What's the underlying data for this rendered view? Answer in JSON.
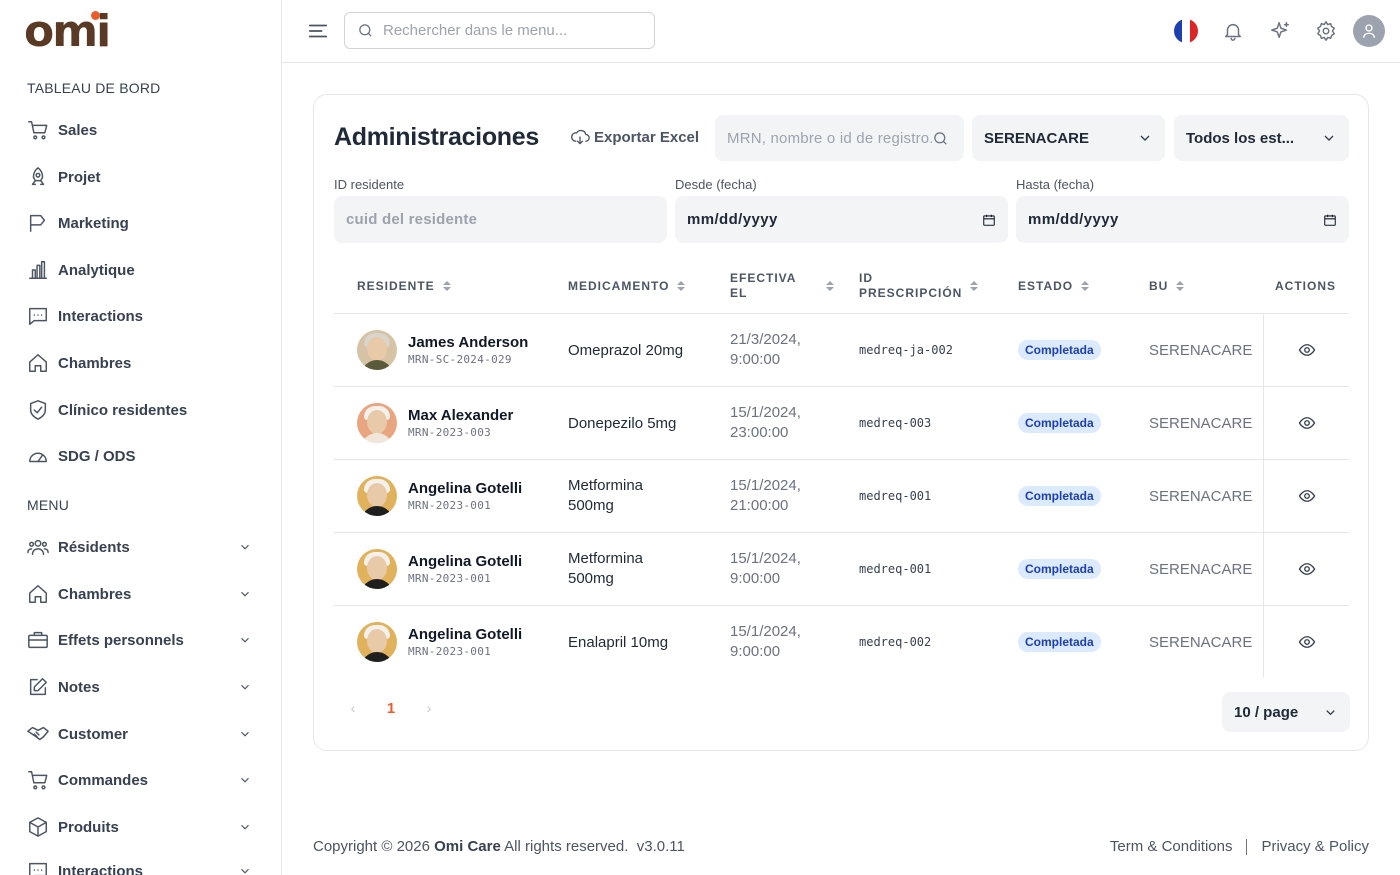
{
  "brand": {
    "name": "omi",
    "accent": "#e85d2b",
    "brown": "#5a3a24"
  },
  "sidebar": {
    "dashboard_title": "TABLEAU DE BORD",
    "dashboard_items": [
      {
        "label": "Sales",
        "icon": "cart-icon"
      },
      {
        "label": "Projet",
        "icon": "rocket-icon"
      },
      {
        "label": "Marketing",
        "icon": "flag-icon"
      },
      {
        "label": "Analytique",
        "icon": "bar-chart-icon"
      },
      {
        "label": "Interactions",
        "icon": "message-icon"
      },
      {
        "label": "Chambres",
        "icon": "home-icon"
      },
      {
        "label": "Clínico residentes",
        "icon": "shield-check-icon"
      },
      {
        "label": "SDG / ODS",
        "icon": "gauge-icon"
      }
    ],
    "menu_title": "MENU",
    "menu_items": [
      {
        "label": "Résidents",
        "icon": "users-icon"
      },
      {
        "label": "Chambres",
        "icon": "home-icon"
      },
      {
        "label": "Effets personnels",
        "icon": "briefcase-icon"
      },
      {
        "label": "Notes",
        "icon": "edit-icon"
      },
      {
        "label": "Customer",
        "icon": "handshake-icon"
      },
      {
        "label": "Commandes",
        "icon": "cart-icon"
      },
      {
        "label": "Produits",
        "icon": "box-icon"
      },
      {
        "label": "Interactions",
        "icon": "message-icon"
      }
    ]
  },
  "topbar": {
    "search_placeholder": "Rechercher dans le menu...",
    "language": "fr",
    "icons": [
      "bell-icon",
      "sparkle-icon",
      "gear-icon",
      "user-avatar-icon"
    ]
  },
  "page": {
    "title": "Administraciones",
    "export_label": "Exportar Excel",
    "search_placeholder": "MRN, nombre o id de registro...",
    "bu_select": "SERENACARE",
    "status_select": "Todos los est...",
    "filters": {
      "resident_label": "ID residente",
      "resident_placeholder": "cuid del residente",
      "from_label": "Desde (fecha)",
      "from_value": "mm/dd/yyyy",
      "to_label": "Hasta (fecha)",
      "to_value": "mm/dd/yyyy"
    },
    "columns": {
      "resident": "RESIDENTE",
      "medication": "MEDICAMENTO",
      "effective_1": "EFECTIVA",
      "effective_2": "EL",
      "prescription_1": "ID",
      "prescription_2": "PRESCRIPCIÓN",
      "status": "ESTADO",
      "bu": "BU",
      "actions": "ACTIONS"
    },
    "rows": [
      {
        "name": "James Anderson",
        "mrn": "MRN-SC-2024-029",
        "med1": "Omeprazol 20mg",
        "med2": "",
        "date": "21/3/2024,",
        "time": "9:00:00",
        "rx": "medreq-ja-002",
        "status": "Completada",
        "bu": "SERENACARE"
      },
      {
        "name": "Max Alexander",
        "mrn": "MRN-2023-003",
        "med1": "Donepezilo 5mg",
        "med2": "",
        "date": "15/1/2024,",
        "time": "23:00:00",
        "rx": "medreq-003",
        "status": "Completada",
        "bu": "SERENACARE"
      },
      {
        "name": "Angelina Gotelli",
        "mrn": "MRN-2023-001",
        "med1": "Metformina",
        "med2": "500mg",
        "date": "15/1/2024,",
        "time": "21:00:00",
        "rx": "medreq-001",
        "status": "Completada",
        "bu": "SERENACARE"
      },
      {
        "name": "Angelina Gotelli",
        "mrn": "MRN-2023-001",
        "med1": "Metformina",
        "med2": "500mg",
        "date": "15/1/2024,",
        "time": "9:00:00",
        "rx": "medreq-001",
        "status": "Completada",
        "bu": "SERENACARE"
      },
      {
        "name": "Angelina Gotelli",
        "mrn": "MRN-2023-001",
        "med1": "Enalapril 10mg",
        "med2": "",
        "date": "15/1/2024,",
        "time": "9:00:00",
        "rx": "medreq-002",
        "status": "Completada",
        "bu": "SERENACARE"
      }
    ],
    "pagination": {
      "prev": "‹",
      "current": "1",
      "next": "›",
      "page_size": "10 / page"
    }
  },
  "footer": {
    "copyright_prefix": "Copyright © 2026",
    "company": "Omi Care",
    "rights": "All rights reserved.",
    "version": "v3.0.11",
    "terms": "Term & Conditions",
    "privacy": "Privacy & Policy"
  }
}
